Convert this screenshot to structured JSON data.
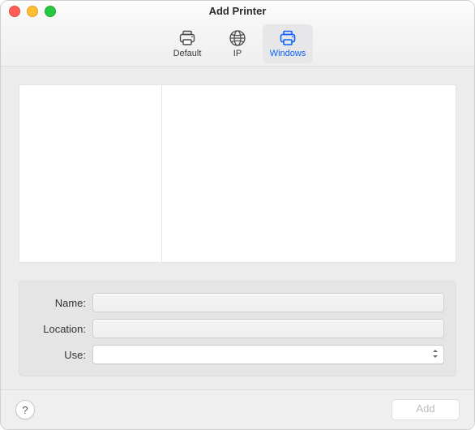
{
  "window": {
    "title": "Add Printer"
  },
  "tabs": [
    {
      "label": "Default",
      "icon": "printer-icon",
      "selected": false
    },
    {
      "label": "IP",
      "icon": "globe-icon",
      "selected": false
    },
    {
      "label": "Windows",
      "icon": "printer-windows-icon",
      "selected": true
    }
  ],
  "form": {
    "name_label": "Name:",
    "name_value": "",
    "location_label": "Location:",
    "location_value": "",
    "use_label": "Use:",
    "use_value": "",
    "use_options": []
  },
  "footer": {
    "help_tooltip": "Help",
    "add_label": "Add",
    "add_enabled": false
  },
  "colors": {
    "accent": "#0a60ff"
  }
}
